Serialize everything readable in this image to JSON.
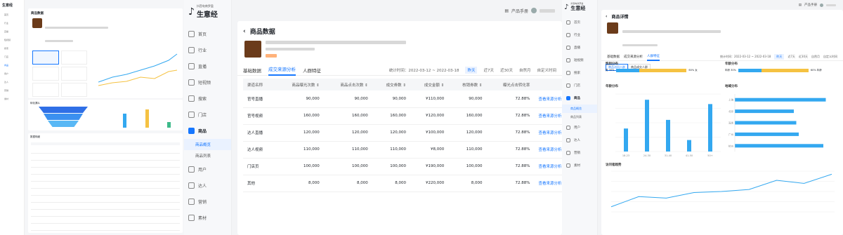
{
  "brand": {
    "small": "抖音电商罗盘",
    "name": "生意经"
  },
  "header": {
    "manual": "产品手册"
  },
  "nav": [
    {
      "label": "首页",
      "icon": "home-icon"
    },
    {
      "label": "行业",
      "icon": "industry-icon"
    },
    {
      "label": "直播",
      "icon": "live-icon"
    },
    {
      "label": "短视频",
      "icon": "video-icon"
    },
    {
      "label": "搜索",
      "icon": "search-icon"
    },
    {
      "label": "门店",
      "icon": "store-icon"
    },
    {
      "label": "商品",
      "icon": "goods-icon"
    },
    {
      "label": "用户",
      "icon": "user-icon"
    },
    {
      "label": "达人",
      "icon": "influencer-icon"
    },
    {
      "label": "营销",
      "icon": "marketing-icon"
    },
    {
      "label": "素材",
      "icon": "material-icon"
    }
  ],
  "goods_sub": [
    "商品概览",
    "商品列表"
  ],
  "page_b": {
    "title": "商品数据",
    "tabs": [
      "基础数据",
      "成交来源分析",
      "人群特征"
    ],
    "stat_time": "统计时间：2022-03-12 ~ 2022-03-18",
    "ranges": [
      "昨天",
      "近7天",
      "近30天",
      "自然月",
      "自定义时间"
    ],
    "columns": [
      "渠道名称",
      "商品曝光次数 ⇕",
      "商品点击次数 ⇕",
      "成交券数 ⇕",
      "成交金额 ⇕",
      "核销券数 ⇕",
      "曝光点击转化率",
      "操作"
    ],
    "rows": [
      [
        "官号直播",
        "90,000",
        "90,000",
        "90,000",
        "¥110,000",
        "90,000",
        "72.88%",
        "查看来源分析"
      ],
      [
        "官号视频",
        "160,000",
        "160,000",
        "160,000",
        "¥120,000",
        "160,000",
        "72.88%",
        "查看来源分析"
      ],
      [
        "达人直播",
        "120,000",
        "120,000",
        "120,000",
        "¥100,000",
        "120,000",
        "72.88%",
        "查看来源分析"
      ],
      [
        "达人视频",
        "110,000",
        "110,000",
        "110,000",
        "¥8,000",
        "110,000",
        "72.88%",
        "查看来源分析"
      ],
      [
        "门店页",
        "100,000",
        "100,000",
        "100,000",
        "¥190,000",
        "100,000",
        "72.88%",
        "查看来源分析"
      ],
      [
        "其他",
        "8,000",
        "8,000",
        "8,000",
        "¥220,000",
        "8,000",
        "72.88%",
        "查看来源分析"
      ]
    ]
  },
  "page_c": {
    "title": "商品详情",
    "tabs": [
      "基础数据",
      "成交来源分析",
      "人群特征"
    ],
    "stat_time": "统计时间：2022-03-12 ~ 2022-03-18",
    "ranges": [
      "昨天",
      "近7天",
      "近30天",
      "自然月",
      "自定义时间"
    ],
    "sub_tabs": [
      "商品访问人群",
      "商品成交人群"
    ],
    "gender": {
      "title": "性别分布",
      "left": "男 30%",
      "right": "60% 女"
    },
    "age": {
      "title": "年龄分布",
      "left": "年龄 30%",
      "right": "60% 年龄"
    },
    "age_chart": {
      "title": "年龄分布",
      "categories": [
        "18-23",
        "24-30",
        "31-40",
        "41-50",
        "50+"
      ],
      "values": [
        800,
        1800,
        1100,
        400,
        1650
      ],
      "ylim": [
        0,
        2000
      ]
    },
    "region": {
      "title": "地域分布",
      "categories": [
        "上海",
        "北京",
        "深圳",
        "广州",
        "杭州"
      ],
      "values": [
        1850,
        1200,
        1250,
        1300,
        1800
      ],
      "xlim": [
        0,
        2000
      ]
    },
    "trend": {
      "title": "访问者趋势",
      "values": [
        500,
        1500,
        1350,
        1900,
        2000,
        2200,
        3100,
        2800,
        3700
      ]
    }
  },
  "page_a": {
    "title": "商品数据",
    "section": "转化漏斗",
    "table_title": "数据明细"
  },
  "colors": {
    "accent": "#1677ff",
    "bar": "#33a8f0",
    "yellow": "#f5c242",
    "price": "#ff6a00"
  }
}
